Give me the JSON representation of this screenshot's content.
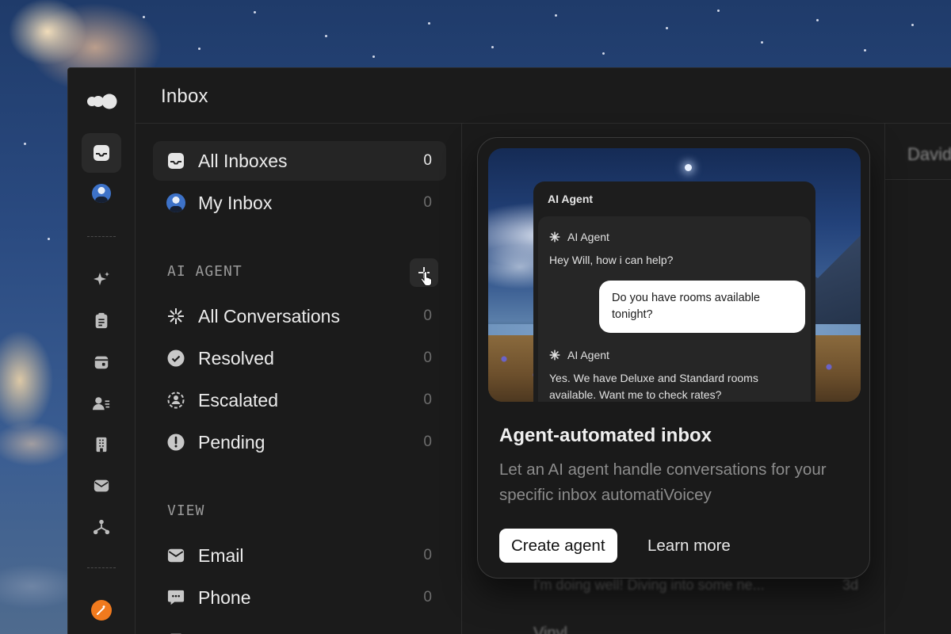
{
  "header": {
    "title": "Inbox"
  },
  "inboxes": [
    {
      "label": "All Inboxes",
      "count": "0",
      "icon": "inbox-icon"
    },
    {
      "label": "My Inbox",
      "count": "0",
      "icon": "avatar"
    }
  ],
  "ai_agent": {
    "heading": "AI AGENT",
    "items": [
      {
        "label": "All Conversations",
        "count": "0",
        "icon": "asterisk-icon"
      },
      {
        "label": "Resolved",
        "count": "0",
        "icon": "check-circle-icon"
      },
      {
        "label": "Escalated",
        "count": "0",
        "icon": "escalated-icon"
      },
      {
        "label": "Pending",
        "count": "0",
        "icon": "exclamation-circle-icon"
      }
    ]
  },
  "view": {
    "heading": "VIEW",
    "items": [
      {
        "label": "Email",
        "count": "0",
        "icon": "mail-icon"
      },
      {
        "label": "Phone",
        "count": "0",
        "icon": "chat-bubble-icon"
      }
    ]
  },
  "card": {
    "chat_title": "AI Agent",
    "messages": [
      {
        "sender": "AI Agent",
        "text": "Hey Will, how i can help?"
      },
      {
        "sender": "user",
        "text": "Do you have rooms available tonight?"
      },
      {
        "sender": "AI Agent",
        "text": "Yes. We have Deluxe and Standard rooms available. Want me to check rates?"
      }
    ],
    "title": "Agent-automated inbox",
    "description": "Let an AI agent handle conversations for your specific inbox automatiVoicey",
    "primary_button": "Create agent",
    "secondary_button": "Learn more"
  },
  "background_list": {
    "row1_preview": "I'm doing well! Diving into some ne...",
    "row1_time": "3d",
    "row2_name": "Vinyl"
  },
  "side_column": {
    "name": "David"
  },
  "colors": {
    "app_bg": "#1b1b1b",
    "accent_orange": "#f07a1e",
    "primary_button_bg": "#ffffff"
  }
}
